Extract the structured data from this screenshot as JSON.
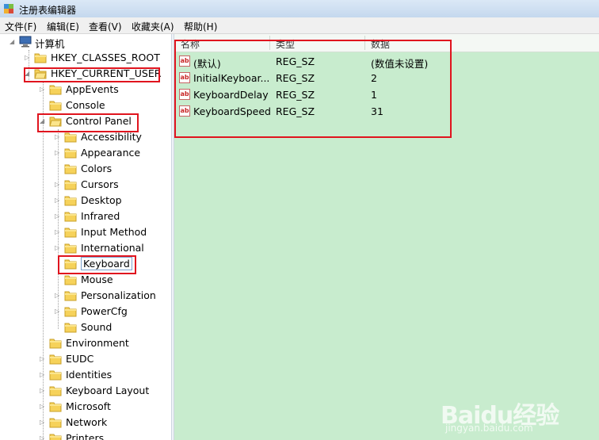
{
  "window": {
    "title": "注册表编辑器"
  },
  "menu": [
    "文件(F)",
    "编辑(E)",
    "查看(V)",
    "收藏夹(A)",
    "帮助(H)"
  ],
  "tree": {
    "root": "计算机",
    "hkcr": "HKEY_CLASSES_ROOT",
    "hkcu": "HKEY_CURRENT_USER",
    "hkcu_children_a": [
      "AppEvents",
      "Console",
      "Control Panel"
    ],
    "control_panel_children": [
      "Accessibility",
      "Appearance",
      "Colors",
      "Cursors",
      "Desktop",
      "Infrared",
      "Input Method",
      "International",
      "Keyboard",
      "Mouse",
      "Personalization",
      "PowerCfg",
      "Sound"
    ],
    "hkcu_children_b": [
      "Environment",
      "EUDC",
      "Identities",
      "Keyboard Layout",
      "Microsoft",
      "Network",
      "Printers"
    ]
  },
  "list": {
    "columns": [
      "名称",
      "类型",
      "数据"
    ],
    "rows": [
      {
        "name": "(默认)",
        "type": "REG_SZ",
        "data": "(数值未设置)"
      },
      {
        "name": "InitialKeyboar...",
        "type": "REG_SZ",
        "data": "2"
      },
      {
        "name": "KeyboardDelay",
        "type": "REG_SZ",
        "data": "1"
      },
      {
        "name": "KeyboardSpeed",
        "type": "REG_SZ",
        "data": "31"
      }
    ],
    "value_icon_text": "ab"
  },
  "watermark": {
    "brand": "Baidu经验",
    "url": "jingyan.baidu.com"
  },
  "colors": {
    "list_bg": "#c8ecce",
    "highlight_red": "#e0141e"
  }
}
